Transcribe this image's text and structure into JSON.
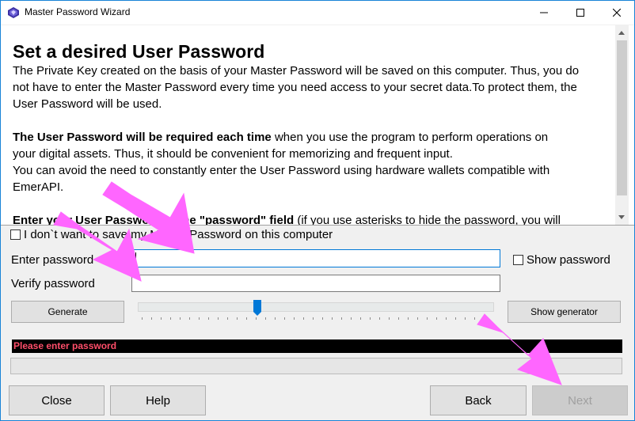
{
  "window": {
    "title": "Master Password Wizard",
    "controls": [
      "minimize",
      "maximize",
      "close"
    ]
  },
  "content": {
    "heading": "Set a desired User Password",
    "para1": [
      "The Private Key created on the basis of your Master Password will be saved on this computer. Thus, you do",
      "not have to enter the Master Password every time you need access to your secret data.To  protect them, the",
      "User Password will be used."
    ],
    "para2_bold": "The User Password will be required each time",
    "para2_rest": "  when you use the program to perform operations on",
    "para2_lines": [
      "your digital assets. Thus, it should be convenient for memorizing and frequent input.",
      "You can avoid the need to constantly enter the User Password using hardware wallets compatible with",
      "EmerAPI."
    ],
    "para3_bold": "Enter your User Password in the \"password\" field",
    "para3_rest": "  (if you use asterisks to hide the password, you will"
  },
  "form": {
    "dont_save_label": "I don`t want to save my Master Password on this computer",
    "enter_password_label": "Enter password",
    "enter_password_value": "",
    "verify_password_label": "Verify password",
    "verify_password_value": "",
    "show_password_label": "Show password",
    "generate_label": "Generate",
    "show_generator_label": "Show generator",
    "slider_value": 0.33,
    "status_text": "Please enter password",
    "progress_value": 0
  },
  "footer": {
    "close_label": "Close",
    "help_label": "Help",
    "back_label": "Back",
    "next_label": "Next"
  },
  "colors": {
    "accent": "#0078d7",
    "status_text": "#ff4e6a",
    "status_bg": "#000000",
    "annotation_arrows": "#ff66ff"
  }
}
